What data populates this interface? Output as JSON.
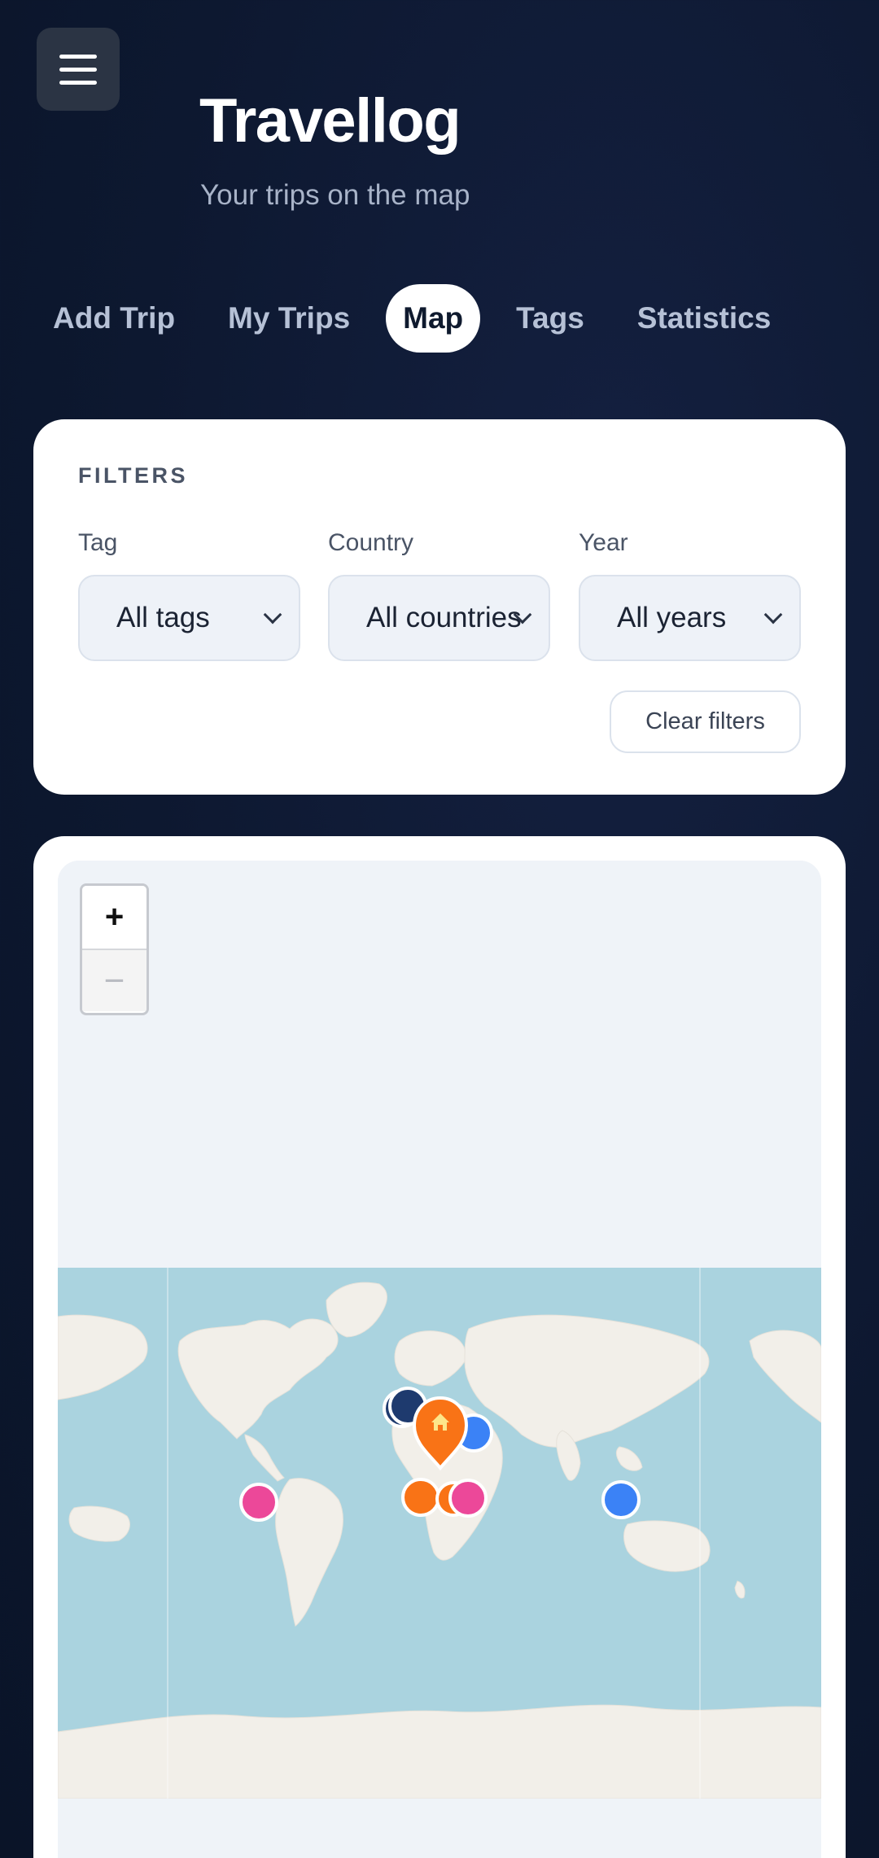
{
  "app": {
    "title": "Travellog",
    "subtitle": "Your trips on the map"
  },
  "header": {
    "menu_icon": "hamburger-icon"
  },
  "tabs": [
    {
      "label": "Add Trip",
      "active": false
    },
    {
      "label": "My Trips",
      "active": false
    },
    {
      "label": "Map",
      "active": true
    },
    {
      "label": "Tags",
      "active": false
    },
    {
      "label": "Statistics",
      "active": false
    }
  ],
  "filters": {
    "heading": "FILTERS",
    "tag": {
      "label": "Tag",
      "value": "All tags"
    },
    "country": {
      "label": "Country",
      "value": "All countries"
    },
    "year": {
      "label": "Year",
      "value": "All years"
    },
    "clear_label": "Clear filters"
  },
  "map": {
    "zoom_in": "+",
    "zoom_out": "−",
    "home_icon": "home-icon",
    "colors": {
      "ocean": "#aad3df",
      "land": "#f2efe9",
      "navy": "#1e3a6e",
      "blue": "#3b82f6",
      "pink": "#ec4899",
      "orange": "#f97316"
    }
  }
}
